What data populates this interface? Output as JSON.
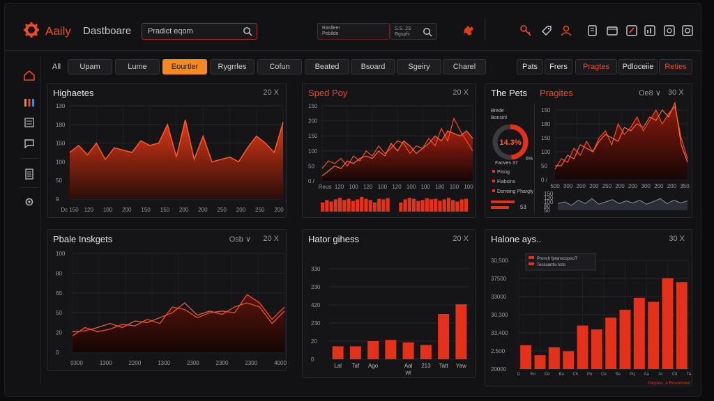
{
  "header": {
    "app_name_accent": "Aaily",
    "app_name": "Dastboare",
    "search_value": "Pradict eqom",
    "combo_line1": "Raslleer",
    "combo_line2": "Pebilde",
    "combo2_line1": "S.S. 2S",
    "combo2_line2": "Rgspfs"
  },
  "tabs": [
    "All",
    "Upam",
    "Lume",
    "Eourtler",
    "Rygrrles",
    "Cofun",
    "Beated",
    "Bsoard",
    "Sgeiry",
    "Charel"
  ],
  "active_tab": "Eourtler",
  "right_tabs": [
    "Pats",
    "Frers",
    "Pragtes",
    "Pdloceiie",
    "Reties"
  ],
  "colors": {
    "accent": "#f04a22",
    "orange": "#f28a1f",
    "bg": "#121215",
    "panel": "#151518"
  },
  "panels": {
    "highlights": {
      "title": "Highaetes",
      "meta": "20 X",
      "y_ticks": [
        "130",
        "180",
        "150",
        "100",
        "50",
        "9"
      ],
      "x_ticks": [
        "Dc 150",
        "120",
        "100",
        "200",
        "150",
        "150",
        "200",
        "200",
        "250",
        "200",
        "250",
        "200"
      ]
    },
    "sped": {
      "title": "Sped Poy",
      "meta": "20 X",
      "y_ticks": [
        "150",
        "200",
        "150",
        "100",
        "50",
        "0 /"
      ],
      "x_ticks": [
        "Reus",
        "120",
        "100",
        "120",
        "100",
        "120",
        "100",
        "100",
        "180",
        "100",
        "100"
      ]
    },
    "thepets": {
      "title": "The Pets",
      "pre1": "Brede",
      "pre2": "Bonsinl",
      "donut_value": "14.3%",
      "donut_side": "6%",
      "donut_bottom": "Faoves 37",
      "legend": [
        "Pinng",
        "Fiabsins",
        "Dsrreing Phargly"
      ],
      "bottom_value": "53"
    },
    "pragtes": {
      "title": "Pragites",
      "meta1": "Oe8 ∨",
      "meta2": "30 X",
      "y_ticks": [
        "150",
        "180",
        "150",
        "100",
        "50",
        "0 /"
      ],
      "x_ticks": [
        "500",
        "300",
        "200",
        "200",
        "250",
        "200",
        "200",
        "300",
        "200",
        "200",
        "350"
      ],
      "mini_ticks": [
        "150",
        "120",
        "100",
        "80",
        "50"
      ]
    },
    "insights": {
      "title": "Pbale Inskgets",
      "meta1": "Osb ∨",
      "meta2": "20 X",
      "y_ticks": [
        "100",
        "80",
        "60",
        "50",
        "20",
        "0"
      ],
      "x_ticks": [
        "0300",
        "1300",
        "2200",
        "1300",
        "2300",
        "2300",
        "2300",
        "4000"
      ]
    },
    "hatorgihess": {
      "title": "Hator gihess",
      "meta": "20 X",
      "y_ticks": [
        "330",
        "230",
        "420",
        "230",
        "20",
        "0"
      ],
      "x_ticks": [
        "Lal",
        "Taf",
        "Ago",
        "",
        "Aal",
        "213",
        "Tatt",
        "Yaw"
      ],
      "x_extra": "Wl"
    },
    "halone": {
      "title": "Halone ays..",
      "meta": "30 X",
      "y_ticks": [
        "30,500",
        "37500",
        "33000",
        "30,300",
        "33,400",
        "2,500",
        "20000"
      ],
      "legend": [
        "Pronch fpranscopsc/7",
        "Tessuantiu ksts"
      ],
      "x_ticks": [
        "D",
        "Eo",
        "Do",
        "Ba",
        "Ch",
        "Po",
        "Ce",
        "Se",
        "Pq",
        "Aa",
        "Ar",
        "Cd",
        "Ta"
      ],
      "footer": "Parpaus, A Roveninted"
    }
  },
  "chart_data": [
    {
      "type": "area",
      "title": "Highaetes",
      "series": [
        {
          "values": [
            100,
            115,
            95,
            120,
            85,
            110,
            105,
            100,
            125,
            115,
            120,
            160,
            90,
            170,
            85,
            135,
            80,
            85,
            90,
            80,
            110,
            135,
            120,
            100,
            165
          ]
        }
      ],
      "ylim": [
        0,
        200
      ]
    },
    {
      "type": "line",
      "title": "Sped Poy",
      "series": [
        {
          "values": [
            50,
            80,
            70,
            90,
            60,
            100,
            80,
            120,
            100,
            140,
            110,
            130,
            160,
            150,
            110,
            140,
            130,
            170,
            140,
            210,
            160,
            250,
            200,
            160,
            120
          ]
        },
        {
          "values": [
            20,
            40,
            60,
            50,
            80,
            70,
            90,
            100,
            90,
            120,
            100,
            150,
            120,
            160,
            140,
            110,
            130,
            150,
            180,
            160,
            200,
            190,
            180,
            200,
            170
          ]
        }
      ],
      "bars": [
        30,
        38,
        33,
        40,
        45,
        38,
        42,
        35,
        40,
        48,
        42,
        38,
        30,
        42,
        40,
        44,
        40,
        38,
        30,
        40,
        45,
        42,
        35,
        38,
        44,
        40,
        42,
        36,
        40,
        45,
        38,
        33,
        40,
        42
      ],
      "ylim": [
        0,
        300
      ]
    },
    {
      "type": "pie",
      "title": "The Pets",
      "values": [
        14.3,
        6,
        79.7
      ]
    },
    {
      "type": "line",
      "title": "Pragites",
      "series": [
        {
          "values": [
            30,
            60,
            50,
            90,
            70,
            110,
            80,
            120,
            140,
            100,
            160,
            130,
            150,
            180,
            140,
            170,
            200,
            160,
            190,
            210,
            120,
            60
          ]
        },
        {
          "values": [
            40,
            40,
            70,
            60,
            100,
            90,
            80,
            110,
            130,
            120,
            110,
            150,
            140,
            160,
            150,
            180,
            170,
            200,
            180,
            220,
            100,
            50
          ]
        }
      ],
      "mini": [
        60,
        65,
        55,
        70,
        60,
        75,
        58,
        65,
        72,
        60,
        68,
        62,
        70,
        58,
        66,
        75,
        60,
        70,
        62,
        68
      ],
      "ylim": [
        0,
        200
      ]
    },
    {
      "type": "line",
      "title": "Pbale Inskgets",
      "series": [
        {
          "values": [
            20,
            30,
            25,
            28,
            34,
            32,
            40,
            35,
            55,
            52,
            42,
            48,
            50,
            48,
            70,
            60,
            40,
            55
          ]
        },
        {
          "values": [
            25,
            26,
            30,
            35,
            30,
            38,
            36,
            42,
            48,
            60,
            45,
            50,
            46,
            55,
            60,
            55,
            35,
            50
          ]
        }
      ],
      "ylim": [
        0,
        120
      ]
    },
    {
      "type": "bar",
      "title": "Hator gihess",
      "values": [
        20,
        20,
        28,
        30,
        26,
        22,
        70,
        85
      ],
      "ylim": [
        0,
        140
      ]
    },
    {
      "type": "bar",
      "title": "Halone ays..",
      "values": [
        12,
        7,
        11,
        9,
        22,
        20,
        26,
        30,
        36,
        34,
        46,
        44
      ],
      "ylim": [
        0,
        55
      ]
    }
  ]
}
